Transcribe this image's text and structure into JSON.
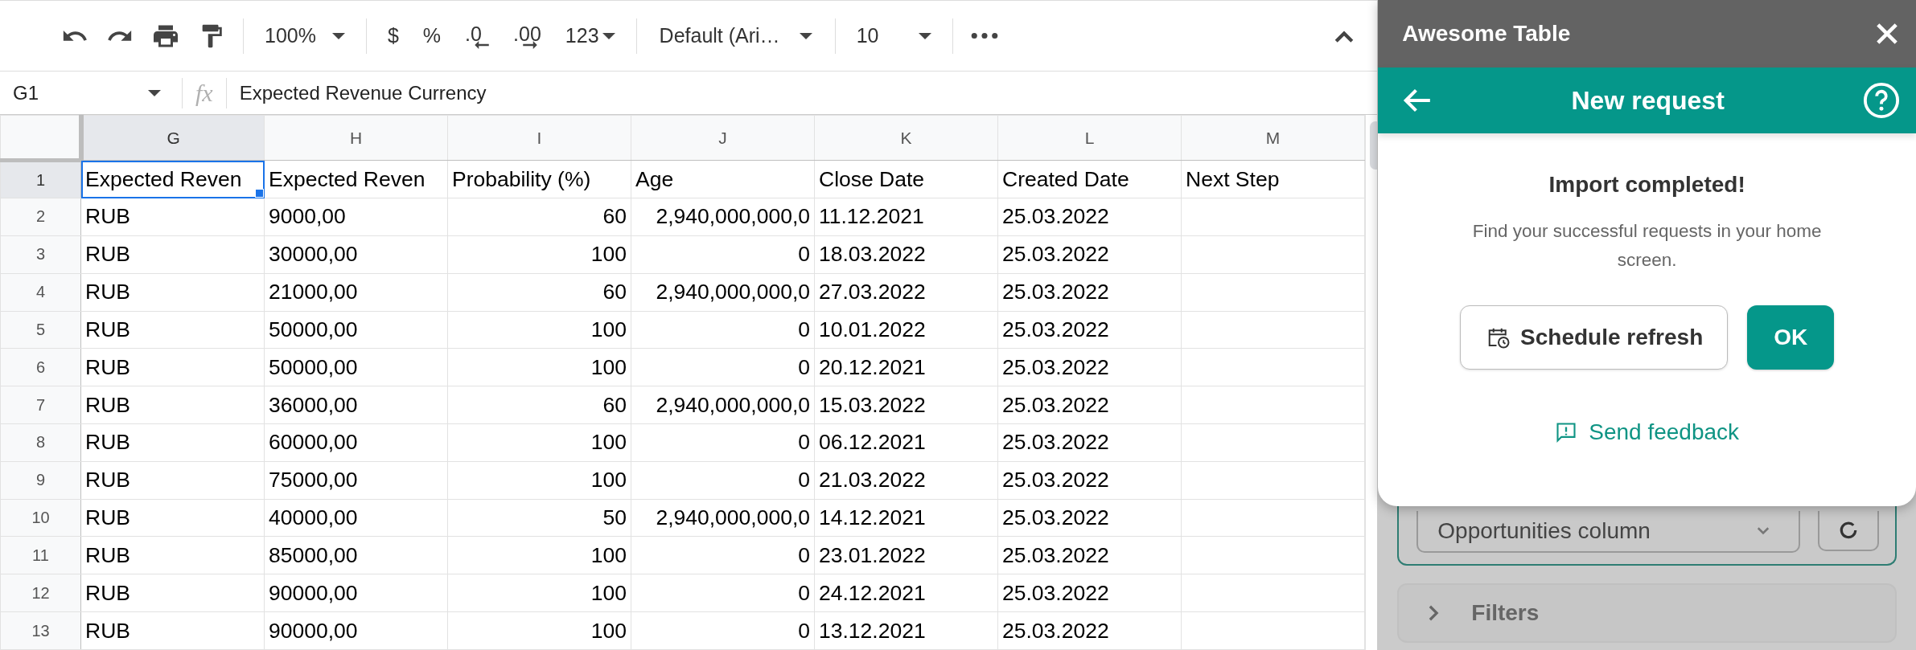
{
  "toolbar": {
    "zoom": "100%",
    "currency": "$",
    "percent": "%",
    "decrease_decimals": ".0",
    "increase_decimals": ".00",
    "number_format": "123",
    "font": "Default (Ari…",
    "font_size": "10"
  },
  "formula_bar": {
    "cell_ref": "G1",
    "function_label": "fx",
    "value": "Expected Revenue Currency"
  },
  "columns": [
    {
      "label": "G",
      "selected": true
    },
    {
      "label": "H",
      "selected": false
    },
    {
      "label": "I",
      "selected": false
    },
    {
      "label": "J",
      "selected": false
    },
    {
      "label": "K",
      "selected": false
    },
    {
      "label": "L",
      "selected": false
    },
    {
      "label": "M",
      "selected": false
    }
  ],
  "rows": [
    {
      "number": "1",
      "selected": true,
      "cells": [
        {
          "text": "Expected Reven",
          "kind": "text"
        },
        {
          "text": "Expected Reven",
          "kind": "text"
        },
        {
          "text": "Probability (%)",
          "kind": "text"
        },
        {
          "text": "Age",
          "kind": "text"
        },
        {
          "text": "Close Date",
          "kind": "text"
        },
        {
          "text": "Created Date",
          "kind": "text"
        },
        {
          "text": "Next Step",
          "kind": "text"
        }
      ]
    },
    {
      "number": "2",
      "selected": false,
      "cells": [
        {
          "text": "RUB",
          "kind": "text"
        },
        {
          "text": "9000,00",
          "kind": "text"
        },
        {
          "text": "60",
          "kind": "number"
        },
        {
          "text": "2,940,000,000,0",
          "kind": "number"
        },
        {
          "text": "11.12.2021",
          "kind": "text"
        },
        {
          "text": "25.03.2022",
          "kind": "text"
        }
      ]
    },
    {
      "number": "3",
      "selected": false,
      "cells": [
        {
          "text": "RUB",
          "kind": "text"
        },
        {
          "text": "30000,00",
          "kind": "text"
        },
        {
          "text": "100",
          "kind": "number"
        },
        {
          "text": "0",
          "kind": "number"
        },
        {
          "text": "18.03.2022",
          "kind": "text"
        },
        {
          "text": "25.03.2022",
          "kind": "text"
        }
      ]
    },
    {
      "number": "4",
      "selected": false,
      "cells": [
        {
          "text": "RUB",
          "kind": "text"
        },
        {
          "text": "21000,00",
          "kind": "text"
        },
        {
          "text": "60",
          "kind": "number"
        },
        {
          "text": "2,940,000,000,0",
          "kind": "number"
        },
        {
          "text": "27.03.2022",
          "kind": "text"
        },
        {
          "text": "25.03.2022",
          "kind": "text"
        }
      ]
    },
    {
      "number": "5",
      "selected": false,
      "cells": [
        {
          "text": "RUB",
          "kind": "text"
        },
        {
          "text": "50000,00",
          "kind": "text"
        },
        {
          "text": "100",
          "kind": "number"
        },
        {
          "text": "0",
          "kind": "number"
        },
        {
          "text": "10.01.2022",
          "kind": "text"
        },
        {
          "text": "25.03.2022",
          "kind": "text"
        }
      ]
    },
    {
      "number": "6",
      "selected": false,
      "cells": [
        {
          "text": "RUB",
          "kind": "text"
        },
        {
          "text": "50000,00",
          "kind": "text"
        },
        {
          "text": "100",
          "kind": "number"
        },
        {
          "text": "0",
          "kind": "number"
        },
        {
          "text": "20.12.2021",
          "kind": "text"
        },
        {
          "text": "25.03.2022",
          "kind": "text"
        }
      ]
    },
    {
      "number": "7",
      "selected": false,
      "cells": [
        {
          "text": "RUB",
          "kind": "text"
        },
        {
          "text": "36000,00",
          "kind": "text"
        },
        {
          "text": "60",
          "kind": "number"
        },
        {
          "text": "2,940,000,000,0",
          "kind": "number"
        },
        {
          "text": "15.03.2022",
          "kind": "text"
        },
        {
          "text": "25.03.2022",
          "kind": "text"
        }
      ]
    },
    {
      "number": "8",
      "selected": false,
      "cells": [
        {
          "text": "RUB",
          "kind": "text"
        },
        {
          "text": "60000,00",
          "kind": "text"
        },
        {
          "text": "100",
          "kind": "number"
        },
        {
          "text": "0",
          "kind": "number"
        },
        {
          "text": "06.12.2021",
          "kind": "text"
        },
        {
          "text": "25.03.2022",
          "kind": "text"
        }
      ]
    },
    {
      "number": "9",
      "selected": false,
      "cells": [
        {
          "text": "RUB",
          "kind": "text"
        },
        {
          "text": "75000,00",
          "kind": "text"
        },
        {
          "text": "100",
          "kind": "number"
        },
        {
          "text": "0",
          "kind": "number"
        },
        {
          "text": "21.03.2022",
          "kind": "text"
        },
        {
          "text": "25.03.2022",
          "kind": "text"
        }
      ]
    },
    {
      "number": "10",
      "selected": false,
      "cells": [
        {
          "text": "RUB",
          "kind": "text"
        },
        {
          "text": "40000,00",
          "kind": "text"
        },
        {
          "text": "50",
          "kind": "number"
        },
        {
          "text": "2,940,000,000,0",
          "kind": "number"
        },
        {
          "text": "14.12.2021",
          "kind": "text"
        },
        {
          "text": "25.03.2022",
          "kind": "text"
        }
      ]
    },
    {
      "number": "11",
      "selected": false,
      "cells": [
        {
          "text": "RUB",
          "kind": "text"
        },
        {
          "text": "85000,00",
          "kind": "text"
        },
        {
          "text": "100",
          "kind": "number"
        },
        {
          "text": "0",
          "kind": "number"
        },
        {
          "text": "23.01.2022",
          "kind": "text"
        },
        {
          "text": "25.03.2022",
          "kind": "text"
        }
      ]
    },
    {
      "number": "12",
      "selected": false,
      "cells": [
        {
          "text": "RUB",
          "kind": "text"
        },
        {
          "text": "90000,00",
          "kind": "text"
        },
        {
          "text": "100",
          "kind": "number"
        },
        {
          "text": "0",
          "kind": "number"
        },
        {
          "text": "24.12.2021",
          "kind": "text"
        },
        {
          "text": "25.03.2022",
          "kind": "text"
        }
      ]
    },
    {
      "number": "13",
      "selected": false,
      "cells": [
        {
          "text": "RUB",
          "kind": "text"
        },
        {
          "text": "90000,00",
          "kind": "text"
        },
        {
          "text": "100",
          "kind": "number"
        },
        {
          "text": "0",
          "kind": "number"
        },
        {
          "text": "13.12.2021",
          "kind": "text"
        },
        {
          "text": "25.03.2022",
          "kind": "text"
        }
      ]
    }
  ],
  "sidebar": {
    "title": "Awesome Table",
    "header": "New request",
    "dialog": {
      "heading": "Import completed!",
      "message": "Find your successful requests in your home screen.",
      "secondary_button": "Schedule refresh",
      "primary_button": "OK",
      "link": "Send feedback"
    },
    "background": {
      "select_value": "Opportunities column",
      "filters_label": "Filters"
    }
  }
}
